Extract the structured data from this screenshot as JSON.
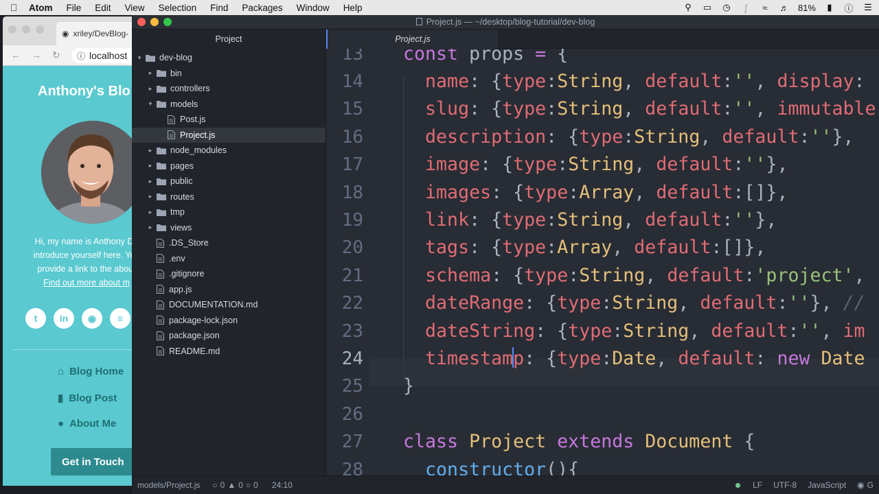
{
  "menubar": {
    "app": "Atom",
    "items": [
      "File",
      "Edit",
      "View",
      "Selection",
      "Find",
      "Packages",
      "Window",
      "Help"
    ],
    "battery": "81%"
  },
  "browser": {
    "tab_title": "xriley/DevBlog-",
    "url": "localhost",
    "blog_title": "Anthony's Blo",
    "bio_lines": [
      "Hi, my name is Anthony Do",
      "introduce yourself here. You",
      "provide a link to the about"
    ],
    "bio_link": "Find out more about m",
    "nav": [
      "Blog Home",
      "Blog Post",
      "About Me"
    ],
    "cta": "Get in Touch"
  },
  "atom": {
    "title": "Project.js — ~/desktop/blog-tutorial/dev-blog",
    "tree_tab": "Project",
    "editor_tab": "Project.js",
    "tree": [
      {
        "name": "dev-blog",
        "type": "folder",
        "open": true,
        "depth": 0
      },
      {
        "name": "bin",
        "type": "folder",
        "open": false,
        "depth": 1
      },
      {
        "name": "controllers",
        "type": "folder",
        "open": false,
        "depth": 1
      },
      {
        "name": "models",
        "type": "folder",
        "open": true,
        "depth": 1
      },
      {
        "name": "Post.js",
        "type": "file",
        "depth": 2
      },
      {
        "name": "Project.js",
        "type": "file",
        "depth": 2,
        "selected": true
      },
      {
        "name": "node_modules",
        "type": "folder",
        "open": false,
        "depth": 1
      },
      {
        "name": "pages",
        "type": "folder",
        "open": false,
        "depth": 1
      },
      {
        "name": "public",
        "type": "folder",
        "open": false,
        "depth": 1
      },
      {
        "name": "routes",
        "type": "folder",
        "open": false,
        "depth": 1
      },
      {
        "name": "tmp",
        "type": "folder",
        "open": false,
        "depth": 1
      },
      {
        "name": "views",
        "type": "folder",
        "open": false,
        "depth": 1
      },
      {
        "name": ".DS_Store",
        "type": "file",
        "depth": 1
      },
      {
        "name": ".env",
        "type": "file",
        "depth": 1
      },
      {
        "name": ".gitignore",
        "type": "file",
        "depth": 1
      },
      {
        "name": "app.js",
        "type": "file",
        "depth": 1
      },
      {
        "name": "DOCUMENTATION.md",
        "type": "file",
        "depth": 1
      },
      {
        "name": "package-lock.json",
        "type": "file",
        "depth": 1
      },
      {
        "name": "package.json",
        "type": "file",
        "depth": 1
      },
      {
        "name": "README.md",
        "type": "file",
        "depth": 1
      }
    ],
    "code": [
      {
        "n": "13",
        "t": [
          [
            "kw",
            "const "
          ],
          [
            "pun",
            "props "
          ],
          [
            "kw",
            "= "
          ],
          [
            "pun",
            "{"
          ]
        ]
      },
      {
        "n": "14",
        "t": [
          [
            "pun",
            "  "
          ],
          [
            "prop",
            "name"
          ],
          [
            "pun",
            ": {"
          ],
          [
            "prop",
            "type"
          ],
          [
            "pun",
            ":"
          ],
          [
            "typ",
            "String"
          ],
          [
            "pun",
            ", "
          ],
          [
            "prop",
            "default"
          ],
          [
            "pun",
            ":"
          ],
          [
            "str",
            "''"
          ],
          [
            "pun",
            ", "
          ],
          [
            "prop",
            "display"
          ],
          [
            "pun",
            ":"
          ]
        ]
      },
      {
        "n": "15",
        "t": [
          [
            "pun",
            "  "
          ],
          [
            "prop",
            "slug"
          ],
          [
            "pun",
            ": {"
          ],
          [
            "prop",
            "type"
          ],
          [
            "pun",
            ":"
          ],
          [
            "typ",
            "String"
          ],
          [
            "pun",
            ", "
          ],
          [
            "prop",
            "default"
          ],
          [
            "pun",
            ":"
          ],
          [
            "str",
            "''"
          ],
          [
            "pun",
            ", "
          ],
          [
            "prop",
            "immutable"
          ]
        ]
      },
      {
        "n": "16",
        "t": [
          [
            "pun",
            "  "
          ],
          [
            "prop",
            "description"
          ],
          [
            "pun",
            ": {"
          ],
          [
            "prop",
            "type"
          ],
          [
            "pun",
            ":"
          ],
          [
            "typ",
            "String"
          ],
          [
            "pun",
            ", "
          ],
          [
            "prop",
            "default"
          ],
          [
            "pun",
            ":"
          ],
          [
            "str",
            "''"
          ],
          [
            "pun",
            "}, "
          ]
        ]
      },
      {
        "n": "17",
        "t": [
          [
            "pun",
            "  "
          ],
          [
            "prop",
            "image"
          ],
          [
            "pun",
            ": {"
          ],
          [
            "prop",
            "type"
          ],
          [
            "pun",
            ":"
          ],
          [
            "typ",
            "String"
          ],
          [
            "pun",
            ", "
          ],
          [
            "prop",
            "default"
          ],
          [
            "pun",
            ":"
          ],
          [
            "str",
            "''"
          ],
          [
            "pun",
            "},"
          ]
        ]
      },
      {
        "n": "18",
        "t": [
          [
            "pun",
            "  "
          ],
          [
            "prop",
            "images"
          ],
          [
            "pun",
            ": {"
          ],
          [
            "prop",
            "type"
          ],
          [
            "pun",
            ":"
          ],
          [
            "typ",
            "Array"
          ],
          [
            "pun",
            ", "
          ],
          [
            "prop",
            "default"
          ],
          [
            "pun",
            ":[]},"
          ]
        ]
      },
      {
        "n": "19",
        "t": [
          [
            "pun",
            "  "
          ],
          [
            "prop",
            "link"
          ],
          [
            "pun",
            ": {"
          ],
          [
            "prop",
            "type"
          ],
          [
            "pun",
            ":"
          ],
          [
            "typ",
            "String"
          ],
          [
            "pun",
            ", "
          ],
          [
            "prop",
            "default"
          ],
          [
            "pun",
            ":"
          ],
          [
            "str",
            "''"
          ],
          [
            "pun",
            "},"
          ]
        ]
      },
      {
        "n": "20",
        "t": [
          [
            "pun",
            "  "
          ],
          [
            "prop",
            "tags"
          ],
          [
            "pun",
            ": {"
          ],
          [
            "prop",
            "type"
          ],
          [
            "pun",
            ":"
          ],
          [
            "typ",
            "Array"
          ],
          [
            "pun",
            ", "
          ],
          [
            "prop",
            "default"
          ],
          [
            "pun",
            ":[]},"
          ]
        ]
      },
      {
        "n": "21",
        "t": [
          [
            "pun",
            "  "
          ],
          [
            "prop",
            "schema"
          ],
          [
            "pun",
            ": {"
          ],
          [
            "prop",
            "type"
          ],
          [
            "pun",
            ":"
          ],
          [
            "typ",
            "String"
          ],
          [
            "pun",
            ", "
          ],
          [
            "prop",
            "default"
          ],
          [
            "pun",
            ":"
          ],
          [
            "str",
            "'project'"
          ],
          [
            "pun",
            ","
          ]
        ]
      },
      {
        "n": "22",
        "t": [
          [
            "pun",
            "  "
          ],
          [
            "prop",
            "dateRange"
          ],
          [
            "pun",
            ": {"
          ],
          [
            "prop",
            "type"
          ],
          [
            "pun",
            ":"
          ],
          [
            "typ",
            "String"
          ],
          [
            "pun",
            ", "
          ],
          [
            "prop",
            "default"
          ],
          [
            "pun",
            ":"
          ],
          [
            "str",
            "''"
          ],
          [
            "pun",
            "}, "
          ],
          [
            "cmt",
            "//"
          ]
        ]
      },
      {
        "n": "23",
        "t": [
          [
            "pun",
            "  "
          ],
          [
            "prop",
            "dateString"
          ],
          [
            "pun",
            ": {"
          ],
          [
            "prop",
            "type"
          ],
          [
            "pun",
            ":"
          ],
          [
            "typ",
            "String"
          ],
          [
            "pun",
            ", "
          ],
          [
            "prop",
            "default"
          ],
          [
            "pun",
            ":"
          ],
          [
            "str",
            "''"
          ],
          [
            "pun",
            ", "
          ],
          [
            "prop",
            "im"
          ]
        ]
      },
      {
        "n": "24",
        "t": [
          [
            "pun",
            "  "
          ],
          [
            "prop",
            "timestamp"
          ],
          [
            "pun",
            ": {"
          ],
          [
            "prop",
            "type"
          ],
          [
            "pun",
            ":"
          ],
          [
            "typ",
            "Date"
          ],
          [
            "pun",
            ", "
          ],
          [
            "prop",
            "default"
          ],
          [
            "pun",
            ": "
          ],
          [
            "kw",
            "new "
          ],
          [
            "typ",
            "Date"
          ]
        ]
      },
      {
        "n": "25",
        "t": [
          [
            "pun",
            "}"
          ]
        ]
      },
      {
        "n": "26",
        "t": []
      },
      {
        "n": "27",
        "t": [
          [
            "kw",
            "class "
          ],
          [
            "typ",
            "Project "
          ],
          [
            "kw",
            "extends "
          ],
          [
            "typ",
            "Document "
          ],
          [
            "pun",
            "{"
          ]
        ]
      },
      {
        "n": "28",
        "t": [
          [
            "pun",
            "  "
          ],
          [
            "fn",
            "constructor"
          ],
          [
            "pun",
            "(){"
          ]
        ]
      }
    ],
    "status": {
      "path": "models/Project.js",
      "errors": "0",
      "warnings": "0",
      "infos": "0",
      "cursor": "24:10",
      "line_ending": "LF",
      "encoding": "UTF-8",
      "grammar": "JavaScript",
      "git": "G"
    }
  }
}
